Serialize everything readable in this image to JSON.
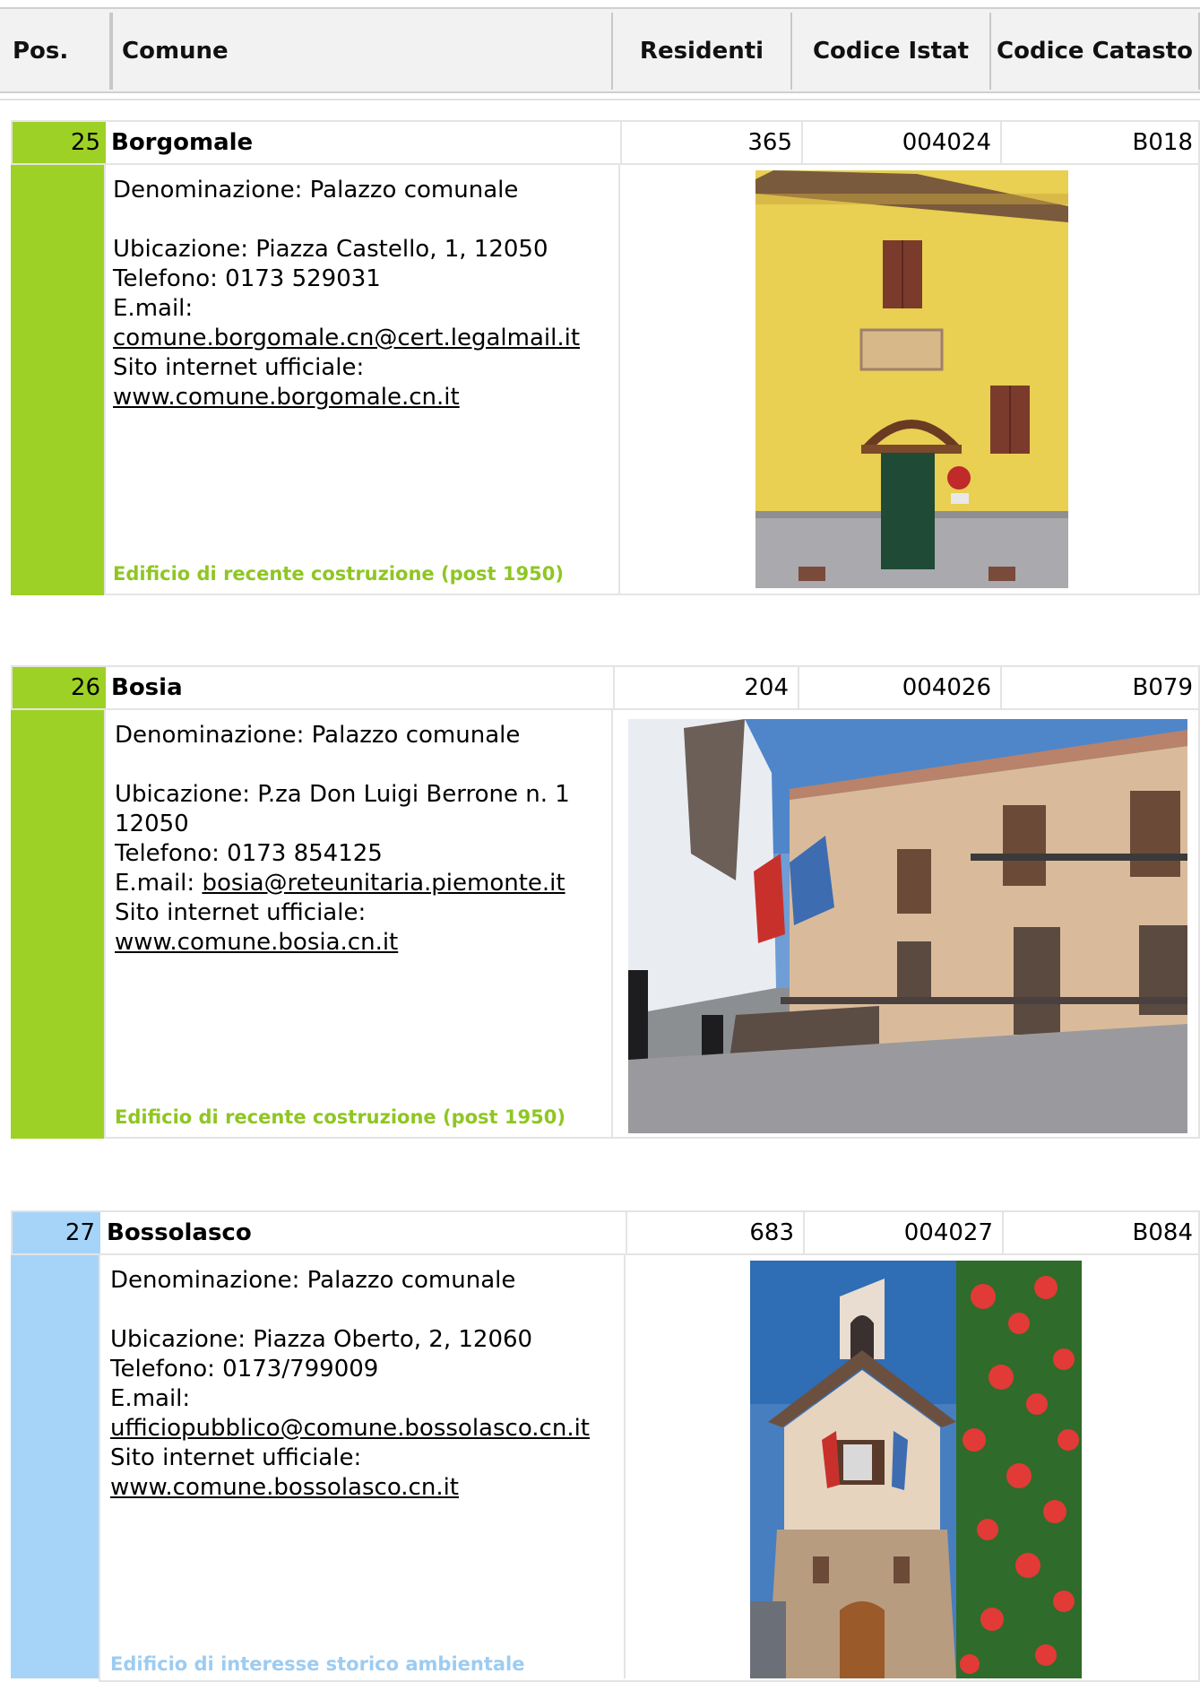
{
  "header": {
    "pos": "Pos.",
    "comune": "Comune",
    "residenti": "Residenti",
    "istat": "Codice Istat",
    "catasto": "Codice Catasto"
  },
  "labels": {
    "denominazione": "Denominazione:",
    "ubicazione": "Ubicazione:",
    "telefono": "Telefono:",
    "email": "E.mail:",
    "sito": "Sito internet ufficiale:"
  },
  "colors": {
    "green": "#9ed126",
    "blue": "#a6d4f8",
    "green_text": "#8fc623",
    "blue_text": "#9cccf2"
  },
  "entries": [
    {
      "pos": "25",
      "comune": "Borgomale",
      "residenti": "365",
      "istat": "004024",
      "catasto": "B018",
      "denominazione": "Palazzo comunale",
      "ubicazione": "Piazza Castello, 1, 12050",
      "telefono": "0173 529031",
      "email": "comune.borgomale.cn@cert.legalmail.it",
      "sito": "www.comune.borgomale.cn.it",
      "note": "Edificio di recente costruzione (post 1950)"
    },
    {
      "pos": "26",
      "comune": "Bosia",
      "residenti": "204",
      "istat": "004026",
      "catasto": "B079",
      "denominazione": "Palazzo comunale",
      "ubicazione": "P.za Don Luigi Berrone n. 1 12050",
      "telefono": "0173 854125",
      "email": "bosia@reteunitaria.piemonte.it",
      "sito": "www.comune.bosia.cn.it",
      "note": "Edificio di recente costruzione (post 1950)"
    },
    {
      "pos": "27",
      "comune": "Bossolasco",
      "residenti": "683",
      "istat": "004027",
      "catasto": "B084",
      "denominazione": "Palazzo comunale",
      "ubicazione": "Piazza Oberto, 2, 12060",
      "telefono": "0173/799009",
      "email": "ufficiopubblico@comune.bossolasco.cn.it",
      "sito": "www.comune.bossolasco.cn.it",
      "note": "Edificio di interesse storico ambientale"
    }
  ]
}
